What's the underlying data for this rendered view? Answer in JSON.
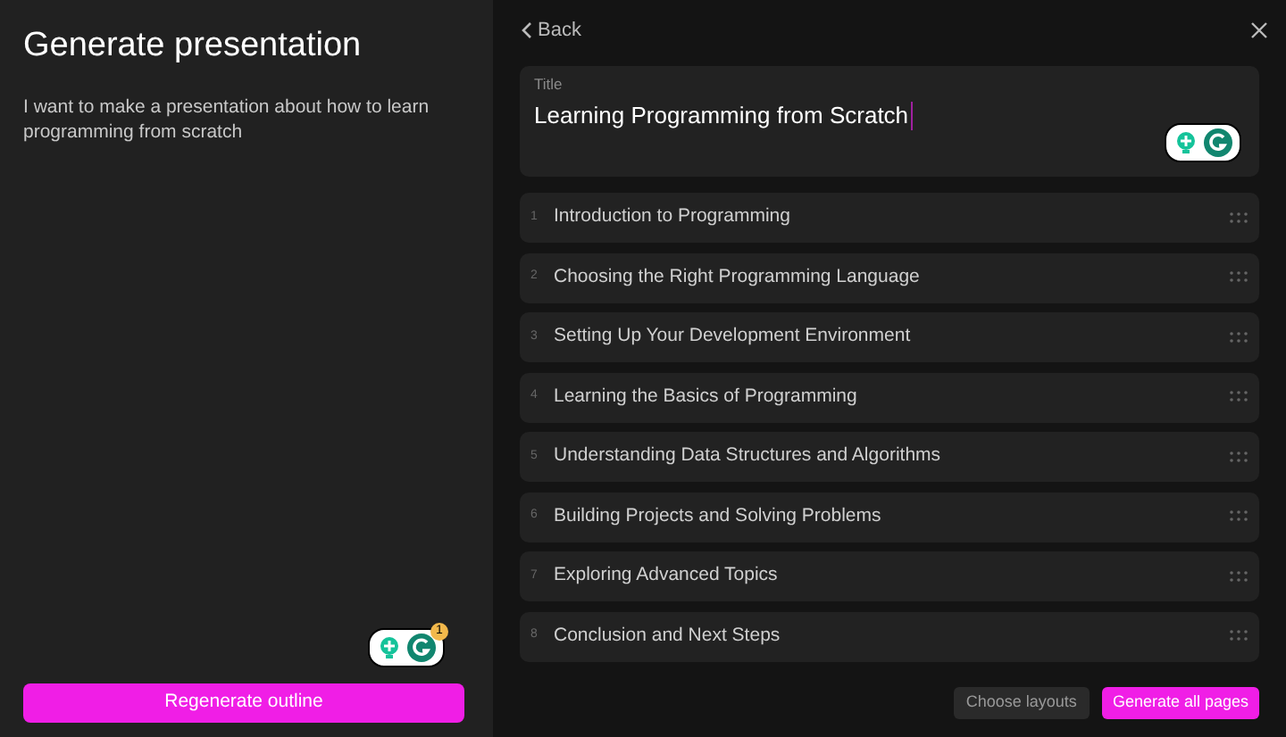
{
  "left": {
    "title": "Generate presentation",
    "prompt": "I want to make a presentation about how to learn programming from scratch",
    "grammarly_badge": {
      "count": "1"
    },
    "regenerate_button": "Regenerate outline"
  },
  "header": {
    "back": "Back"
  },
  "title_card": {
    "label": "Title",
    "value": "Learning Programming from Scratch"
  },
  "outline": [
    {
      "number": "1",
      "text": "Introduction to Programming"
    },
    {
      "number": "2",
      "text": "Choosing the Right Programming Language"
    },
    {
      "number": "3",
      "text": "Setting Up Your Development Environment"
    },
    {
      "number": "4",
      "text": "Learning the Basics of Programming"
    },
    {
      "number": "5",
      "text": "Understanding Data Structures and Algorithms"
    },
    {
      "number": "6",
      "text": "Building Projects and Solving Problems"
    },
    {
      "number": "7",
      "text": "Exploring Advanced Topics"
    },
    {
      "number": "8",
      "text": "Conclusion and Next Steps"
    }
  ],
  "footer": {
    "choose_layouts": "Choose layouts",
    "generate": "Generate all pages"
  }
}
